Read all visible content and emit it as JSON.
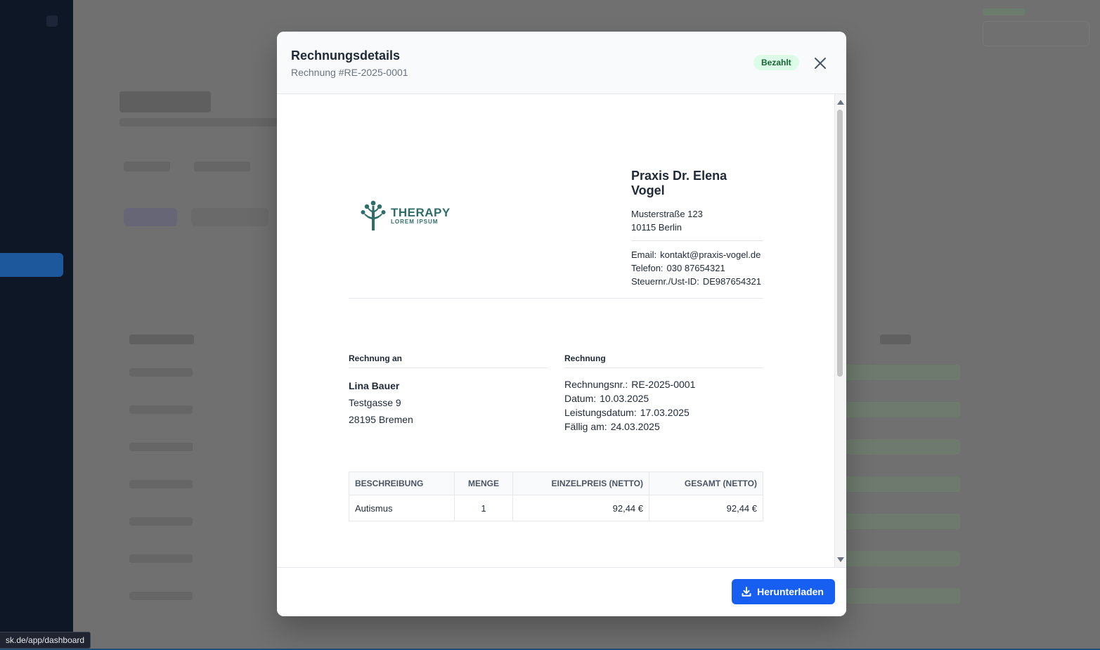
{
  "background": {
    "status_url": "sk.de/app/dashboard"
  },
  "modal": {
    "title": "Rechnungsdetails",
    "subtitle": "Rechnung #RE-2025-0001",
    "badge": "Bezahlt",
    "close_icon": "close-icon",
    "download_label": "Herunterladen",
    "download_icon": "download-icon"
  },
  "invoice": {
    "logo": {
      "main": "THERAPY",
      "sub": "LOREM IPSUM"
    },
    "practice": {
      "name": "Praxis Dr. Elena Vogel",
      "street": "Musterstraße 123",
      "city": "10115 Berlin",
      "email_label": "Email:",
      "email": "kontakt@praxis-vogel.de",
      "phone_label": "Telefon:",
      "phone": "030 87654321",
      "tax_label": "Steuernr./Ust-ID:",
      "tax": "DE987654321"
    },
    "recipient": {
      "heading": "Rechnung an",
      "name": "Lina Bauer",
      "street": "Testgasse 9",
      "city": "28195 Bremen"
    },
    "meta": {
      "heading": "Rechnung",
      "number_label": "Rechnungsnr.:",
      "number": "RE-2025-0001",
      "date_label": "Datum:",
      "date": "10.03.2025",
      "service_label": "Leistungsdatum:",
      "service_date": "17.03.2025",
      "due_label": "Fällig am:",
      "due_date": "24.03.2025"
    },
    "table": {
      "headers": [
        "BESCHREIBUNG",
        "MENGE",
        "EINZELPREIS (NETTO)",
        "GESAMT (NETTO)"
      ],
      "rows": [
        [
          "Autismus",
          "1",
          "92,44 €",
          "92,44 €"
        ]
      ]
    }
  },
  "colors": {
    "primary": "#175ff0",
    "badge_bg": "#dcfce7",
    "badge_text": "#166534",
    "logo": "#2f6d6b"
  }
}
